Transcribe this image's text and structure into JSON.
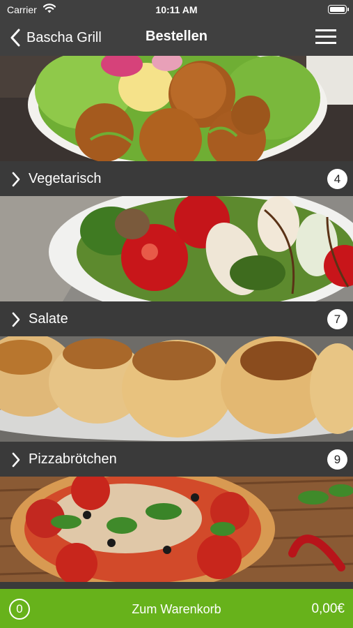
{
  "statusbar": {
    "carrier": "Carrier",
    "time": "10:11 AM"
  },
  "navbar": {
    "back_label": "Bascha Grill",
    "title": "Bestellen"
  },
  "categories": [
    {
      "name": "Vegetarisch",
      "count": "4",
      "image": "falafel-salad-bowl"
    },
    {
      "name": "Salate",
      "count": "7",
      "image": "tomato-chicken-salad"
    },
    {
      "name": "Pizzabrötchen",
      "count": "9",
      "image": "pizza-rolls"
    },
    {
      "name": "",
      "count": "",
      "image": "pizza-with-basil-and-chili"
    }
  ],
  "cart": {
    "count": "0",
    "label": "Zum Warenkorb",
    "total": "0,00€"
  },
  "colors": {
    "bar": "#3a3a3a",
    "header": "#404040",
    "cart_accent": "#67b21b"
  },
  "icons": {
    "back": "chevron-left-icon",
    "menu": "hamburger-menu-icon",
    "row": "chevron-right-icon",
    "wifi": "wifi-icon",
    "battery": "battery-icon"
  }
}
